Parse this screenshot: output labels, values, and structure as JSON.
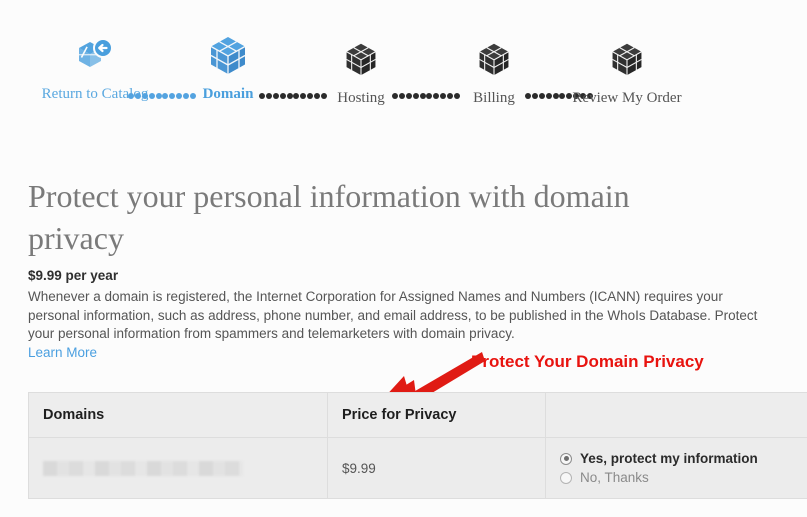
{
  "stepper": {
    "steps": [
      {
        "label": "Return to Catalog",
        "icon": "cube-back-arrow-icon",
        "state": "link"
      },
      {
        "label": "Domain",
        "icon": "cube-icon",
        "state": "active"
      },
      {
        "label": "Hosting",
        "icon": "cube-icon",
        "state": "plain"
      },
      {
        "label": "Billing",
        "icon": "cube-icon",
        "state": "plain"
      },
      {
        "label": "Review My Order",
        "icon": "cube-icon",
        "state": "plain"
      }
    ],
    "connector_colors": [
      "#54a3e0",
      "#2b2b2b",
      "#2b2b2b",
      "#2b2b2b"
    ]
  },
  "content": {
    "title": "Protect your personal information with domain privacy",
    "price_line": "$9.99 per year",
    "description": "Whenever a domain is registered, the Internet Corporation for Assigned Names and Numbers (ICANN) requires your personal information, such as address, phone number, and email address, to be published in the WhoIs Database. Protect your personal information from spammers and telemarketers with domain privacy.",
    "learn_more": "Learn More"
  },
  "annotation": {
    "text": "Protect Your Domain Privacy",
    "color": "#e8130f"
  },
  "table": {
    "headers": [
      "Domains",
      "Price for Privacy",
      ""
    ],
    "rows": [
      {
        "domain": "",
        "domain_redacted": true,
        "price": "$9.99",
        "options": [
          {
            "label": "Yes, protect my information",
            "selected": true
          },
          {
            "label": "No, Thanks",
            "selected": false
          }
        ]
      }
    ]
  }
}
